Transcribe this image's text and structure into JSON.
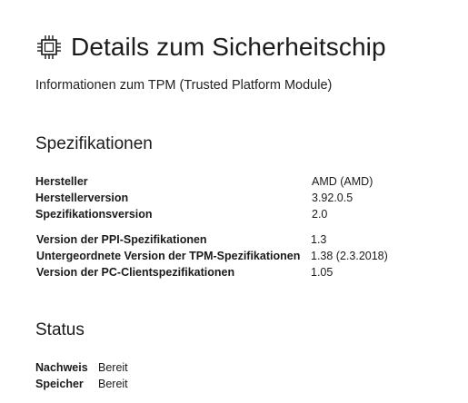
{
  "header": {
    "icon": "chip-icon",
    "title": "Details zum Sicherheitschip",
    "subtitle": "Informationen zum TPM (Trusted Platform Module)"
  },
  "specs": {
    "heading": "Spezifikationen",
    "rows": [
      {
        "label": "Hersteller",
        "value": "AMD (AMD)"
      },
      {
        "label": "Herstellerversion",
        "value": "3.92.0.5"
      },
      {
        "label": "Spezifikationsversion",
        "value": "2.0"
      },
      {
        "label": "Version der PPI-Spezifikationen",
        "value": "1.3"
      },
      {
        "label": "Untergeordnete Version der TPM-Spezifikationen",
        "value": "1.38 (2.3.2018)"
      },
      {
        "label": "Version der PC-Clientspezifikationen",
        "value": "1.05"
      }
    ]
  },
  "status": {
    "heading": "Status",
    "rows": [
      {
        "label": "Nachweis",
        "value": "Bereit"
      },
      {
        "label": "Speicher",
        "value": "Bereit"
      }
    ]
  }
}
